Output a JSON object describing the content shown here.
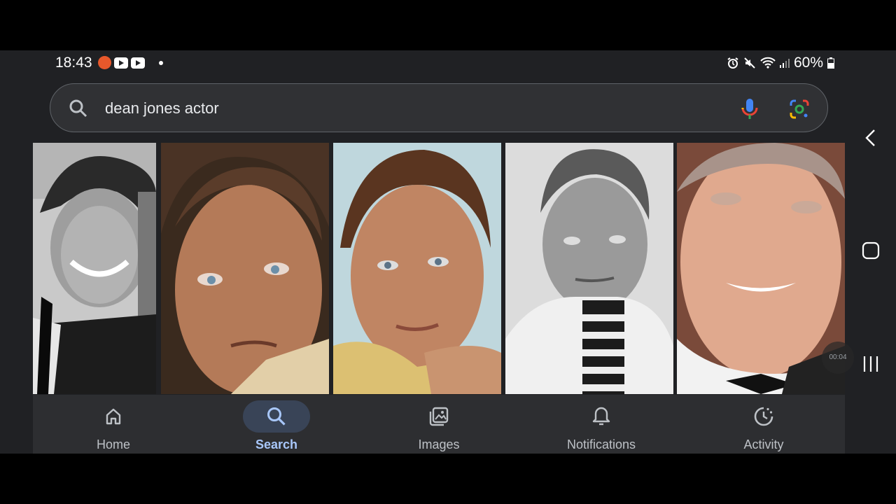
{
  "status_bar": {
    "time": "18:43",
    "battery": "60%"
  },
  "search": {
    "query": "dean jones actor"
  },
  "images": [
    {
      "alt": "dean jones actor image 1"
    },
    {
      "alt": "dean jones actor image 2"
    },
    {
      "alt": "dean jones actor image 3"
    },
    {
      "alt": "dean jones actor image 4"
    },
    {
      "alt": "dean jones actor image 5"
    }
  ],
  "video_overlay": {
    "time": "00:04"
  },
  "bottom_nav": {
    "home": "Home",
    "search": "Search",
    "images": "Images",
    "notifications": "Notifications",
    "activity": "Activity"
  },
  "colors": {
    "background": "#202124",
    "active_tab": "#a8c7fa",
    "active_pill": "#394457"
  }
}
